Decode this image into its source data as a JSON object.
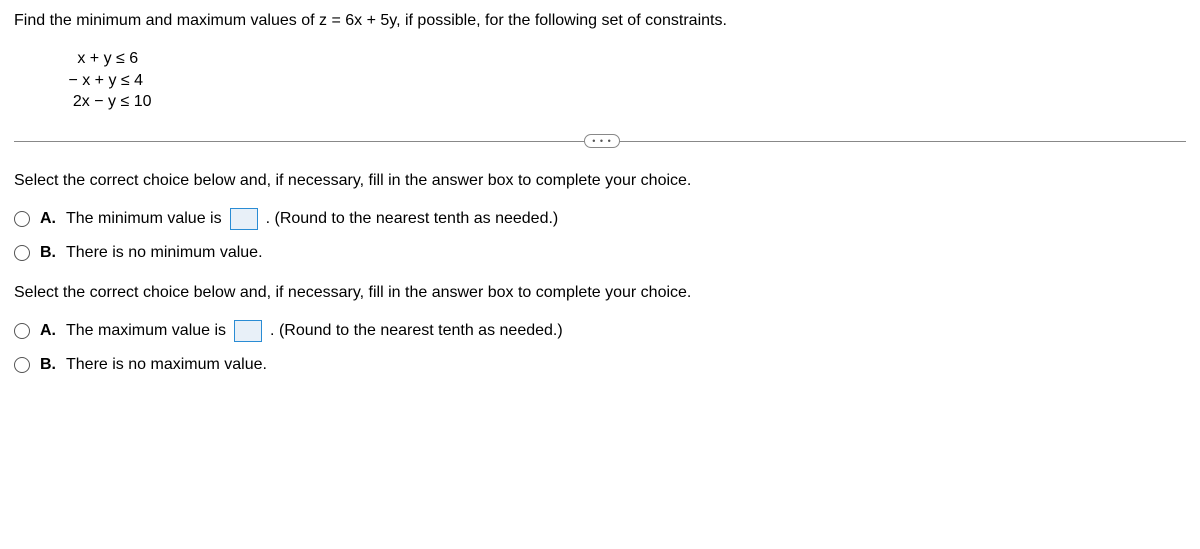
{
  "question": "Find the minimum and maximum values of z = 6x + 5y, if possible, for the following set of constraints.",
  "constraints": {
    "line1": "   x + y ≤ 6",
    "line2": " − x + y ≤ 4",
    "line3": "  2x − y ≤ 10"
  },
  "more": "• • •",
  "section1": {
    "instruction": "Select the correct choice below and, if necessary, fill in the answer box to complete your choice.",
    "choiceA": {
      "label": "A.",
      "text_before": "The minimum value is",
      "text_after": ". (Round to the nearest tenth as needed.)"
    },
    "choiceB": {
      "label": "B.",
      "text": "There is no minimum value."
    }
  },
  "section2": {
    "instruction": "Select the correct choice below and, if necessary, fill in the answer box to complete your choice.",
    "choiceA": {
      "label": "A.",
      "text_before": "The maximum value is",
      "text_after": ". (Round to the nearest tenth as needed.)"
    },
    "choiceB": {
      "label": "B.",
      "text": "There is no maximum value."
    }
  }
}
